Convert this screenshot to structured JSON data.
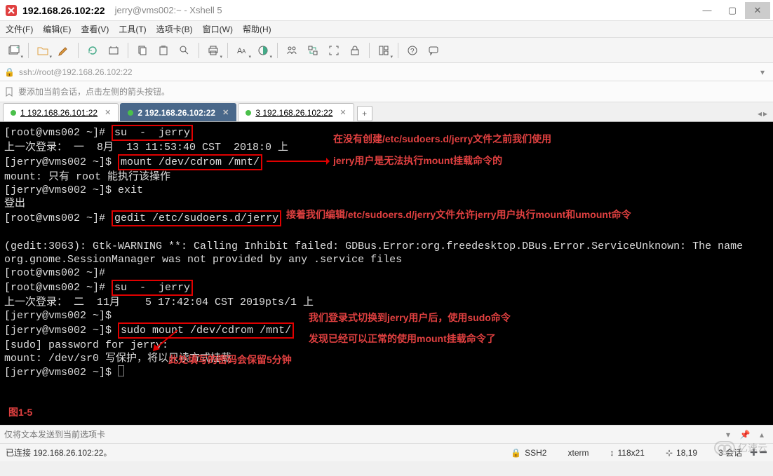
{
  "title": {
    "ip": "192.168.26.102:22",
    "sub": "jerry@vms002:~ - Xshell 5"
  },
  "menu": [
    "文件(F)",
    "编辑(E)",
    "查看(V)",
    "工具(T)",
    "选项卡(B)",
    "窗口(W)",
    "帮助(H)"
  ],
  "address": "ssh://root@192.168.26.102:22",
  "info_hint": "要添加当前会话，点击左侧的箭头按钮。",
  "tabs": [
    {
      "label": "1 192.168.26.101:22",
      "active": false
    },
    {
      "label": "2 192.168.26.102:22",
      "active": true
    },
    {
      "label": "3 192.168.26.102:22",
      "active": false
    }
  ],
  "terminal": {
    "l1a": "[root@vms002 ~]# ",
    "l1b": "su  -  jerry",
    "l2": "上一次登录： 一  8月  13 11:53:40 CST  2018:0 上",
    "l3a": "[jerry@vms002 ~]$ ",
    "l3b": "mount /dev/cdrom /mnt/",
    "l4": "mount: 只有 root 能执行该操作",
    "l5": "[jerry@vms002 ~]$ exit",
    "l6": "登出",
    "l7a": "[root@vms002 ~]# ",
    "l7b": "gedit /etc/sudoers.d/jerry",
    "l8": "",
    "l9": "(gedit:3063): Gtk-WARNING **: Calling Inhibit failed: GDBus.Error:org.freedesktop.DBus.Error.ServiceUnknown: The name",
    "l10": "org.gnome.SessionManager was not provided by any .service files",
    "l11": "[root@vms002 ~]#",
    "l12a": "[root@vms002 ~]# ",
    "l12b": "su  -  jerry",
    "l13": "上一次登录： 二  11月    5 17:42:04 CST 2019pts/1 上",
    "l14": "[jerry@vms002 ~]$",
    "l15a": "[jerry@vms002 ~]$ ",
    "l15b": "sudo mount /dev/cdrom /mnt/",
    "l16": "[sudo] password for jerry:",
    "l17": "mount: /dev/sr0 写保护，将以只读方式挂载",
    "l18": "[jerry@vms002 ~]$ "
  },
  "annotations": {
    "a1": "在没有创建/etc/sudoers.d/jerry文件之前我们使用",
    "a2": "jerry用户是无法执行mount挂载命令的",
    "a3": "接着我们编辑/etc/sudoers.d/jerry文件允许jerry用户执行mount和umount命令",
    "a4": "我们登录式切换到jerry用户后，使用sudo命令",
    "a5": "发现已经可以正常的使用mount挂载命令了",
    "a6": "此处填写的密码会保留5分钟",
    "fig": "图1-5"
  },
  "sendbar_placeholder": "仅将文本发送到当前选项卡",
  "status": {
    "conn": "已连接 192.168.26.102:22。",
    "ssh": "SSH2",
    "term": "xterm",
    "size": "118x21",
    "pos": "18,19",
    "sess": "3 会话"
  },
  "watermark": "亿速云"
}
